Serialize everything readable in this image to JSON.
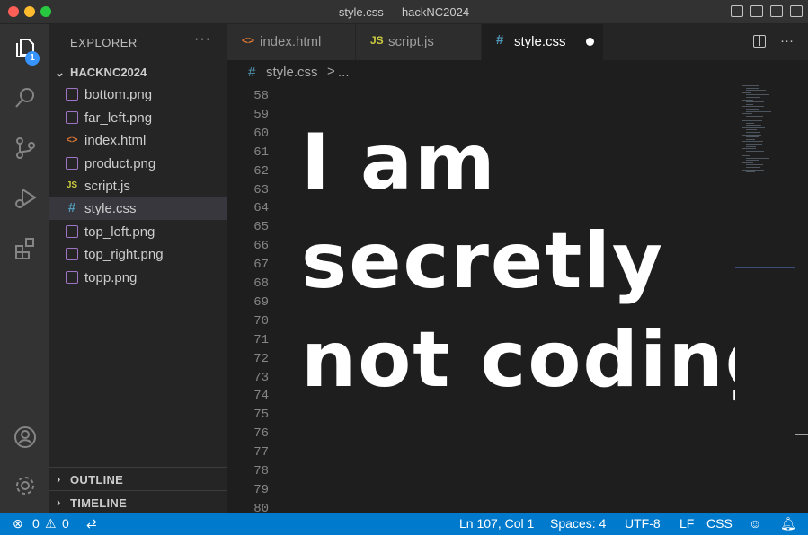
{
  "window": {
    "title": "style.css — hackNC2024"
  },
  "activity_bar": {
    "explorer_badge": "1"
  },
  "sidebar": {
    "header": "EXPLORER",
    "more": "···",
    "folder": "HACKNC2024",
    "files": [
      {
        "name": "bottom.png",
        "type": "png"
      },
      {
        "name": "far_left.png",
        "type": "png"
      },
      {
        "name": "index.html",
        "type": "html",
        "icon": "<>"
      },
      {
        "name": "product.png",
        "type": "png"
      },
      {
        "name": "script.js",
        "type": "js",
        "icon": "JS"
      },
      {
        "name": "style.css",
        "type": "css",
        "icon": "#",
        "active": true
      },
      {
        "name": "top_left.png",
        "type": "png"
      },
      {
        "name": "top_right.png",
        "type": "png"
      },
      {
        "name": "topp.png",
        "type": "png"
      }
    ],
    "sections": [
      "OUTLINE",
      "TIMELINE"
    ]
  },
  "tabs": [
    {
      "label": "index.html",
      "icon": "<>",
      "icon_color": "#e37933"
    },
    {
      "label": "script.js",
      "icon": "JS",
      "icon_color": "#cbcb41"
    },
    {
      "label": "style.css",
      "icon": "#",
      "icon_color": "#519aba",
      "active": true,
      "unsaved": true
    }
  ],
  "breadcrumb": {
    "icon": "#",
    "file": "style.css",
    "separator": ">",
    "more": "..."
  },
  "editor": {
    "line_numbers": [
      "58",
      "59",
      "60",
      "61",
      "62",
      "63",
      "64",
      "65",
      "66",
      "67",
      "68",
      "69",
      "70",
      "71",
      "72",
      "73",
      "74",
      "75",
      "76",
      "77",
      "78",
      "79",
      "80"
    ],
    "overlay_text": [
      "I am",
      "secretly",
      "not coding"
    ]
  },
  "status_bar": {
    "errors": "0",
    "warnings": "0",
    "position": "Ln 107, Col 1",
    "spaces": "Spaces: 4",
    "encoding": "UTF-8",
    "eol": "LF",
    "language": "CSS"
  },
  "colors": {
    "accent": "#007acc",
    "badge": "#3794ff",
    "activity_bar": "#333333",
    "sidebar": "#252526",
    "editor": "#1e1e1e"
  }
}
